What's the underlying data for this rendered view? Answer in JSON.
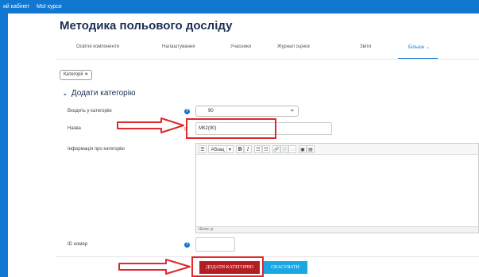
{
  "top_nav": {
    "items": [
      "ий кабінет",
      "Мої курси"
    ]
  },
  "page": {
    "title": "Методика польового досліду"
  },
  "tabs": [
    {
      "label": "Освітні компоненти"
    },
    {
      "label": "Налаштування"
    },
    {
      "label": "Учасники"
    },
    {
      "label": "Журнал оцінок"
    },
    {
      "label": "Звіти"
    },
    {
      "label": "Більше ⌄"
    }
  ],
  "category_selector": {
    "label": "Категорії ≑"
  },
  "section": {
    "title": "Додати категорію",
    "chevron": "⌄"
  },
  "form": {
    "parent": {
      "label": "Входить у категорію",
      "value": "90",
      "arrow": "≑"
    },
    "name": {
      "label": "Назва",
      "value": "МК2(90)",
      "required_mark": "!"
    },
    "info": {
      "label": "Інформація про категорію"
    },
    "idnumber": {
      "label": "ID номер",
      "value": ""
    },
    "help_mark": "?"
  },
  "editor": {
    "buttons": [
      "☰",
      "Абзац",
      "▾",
      "B",
      "I",
      "☷",
      "☷",
      "🔗",
      "⛓",
      "▭",
      "▣",
      "▤"
    ],
    "path": "Шлях: p"
  },
  "actions": {
    "add_label": "ДОДАТИ КАТЕГОРІЮ",
    "cancel_label": "СКАСУВАТИ"
  },
  "colors": {
    "accent": "#1177d1",
    "highlight_red": "#e0282e",
    "add_button": "#b41e22",
    "cancel_button": "#1aa7e3"
  }
}
